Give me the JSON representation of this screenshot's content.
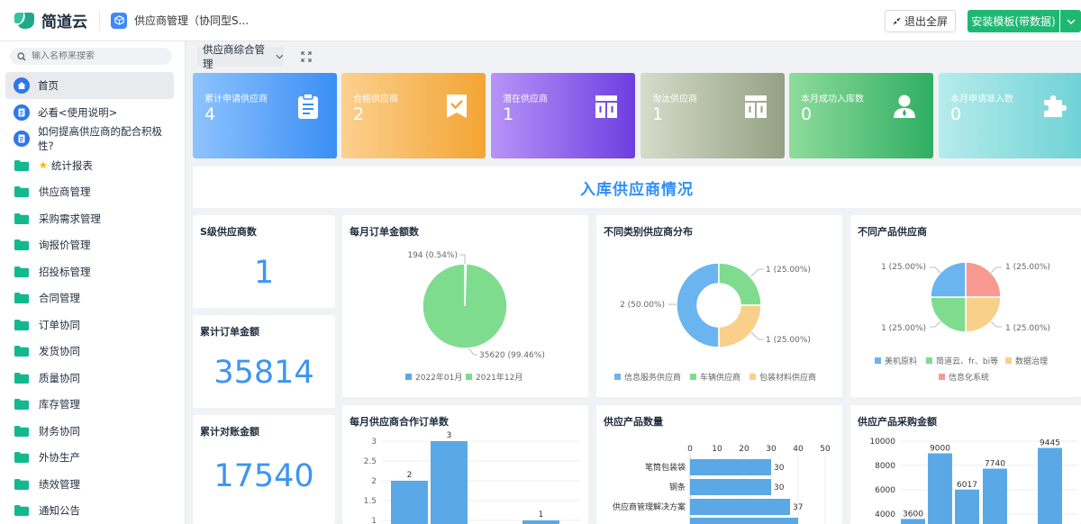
{
  "topbar": {
    "logo_text": "简道云",
    "app_title": "供应商管理（协同型S...",
    "exit_label": "退出全屏",
    "install_label": "安装模板(带数据)"
  },
  "sidebar": {
    "search_placeholder": "输入名称来搜索",
    "items": [
      {
        "label": "首页",
        "type": "home"
      },
      {
        "label": "必看<使用说明>",
        "type": "doc"
      },
      {
        "label": "如何提高供应商的配合积极性?",
        "type": "doc"
      },
      {
        "label": "统计报表",
        "type": "folder-star"
      },
      {
        "label": "供应商管理",
        "type": "folder"
      },
      {
        "label": "采购需求管理",
        "type": "folder"
      },
      {
        "label": "询报价管理",
        "type": "folder"
      },
      {
        "label": "招投标管理",
        "type": "folder"
      },
      {
        "label": "合同管理",
        "type": "folder"
      },
      {
        "label": "订单协同",
        "type": "folder"
      },
      {
        "label": "发货协同",
        "type": "folder"
      },
      {
        "label": "质量协同",
        "type": "folder"
      },
      {
        "label": "库存管理",
        "type": "folder"
      },
      {
        "label": "财务协同",
        "type": "folder"
      },
      {
        "label": "外协生产",
        "type": "folder"
      },
      {
        "label": "绩效管理",
        "type": "folder"
      },
      {
        "label": "通知公告",
        "type": "folder"
      }
    ]
  },
  "toolbar": {
    "dashboard_select": "供应商综合管理"
  },
  "kpis": [
    {
      "label": "累计申请供应商",
      "value": "4",
      "icon": "clipboard-icon",
      "from": "#8ec3ff",
      "to": "#3a8ef5"
    },
    {
      "label": "合格供应商",
      "value": "2",
      "icon": "ribbon-check-icon",
      "from": "#fcd08f",
      "to": "#f3a533"
    },
    {
      "label": "潜在供应商",
      "value": "1",
      "icon": "columns-icon",
      "from": "#b794f8",
      "to": "#6d3ee0"
    },
    {
      "label": "淘汰供应商",
      "value": "1",
      "icon": "columns-icon",
      "from": "#d6dccb",
      "to": "#94a183"
    },
    {
      "label": "本月成功入库数",
      "value": "0",
      "icon": "user-icon",
      "from": "#8fdc9c",
      "to": "#2fae62"
    },
    {
      "label": "本月申请准入数",
      "value": "0",
      "icon": "puzzle-icon",
      "from": "#b6ecec",
      "to": "#6fd2d6"
    }
  ],
  "banner": {
    "title": "入库供应商情况"
  },
  "stats": [
    {
      "title": "S级供应商数",
      "value": "1"
    },
    {
      "title": "累计订单金额",
      "value": "35814"
    },
    {
      "title": "累计对账金额",
      "value": "17540"
    }
  ],
  "chart_data": [
    {
      "type": "pie",
      "title": "每月订单金额数",
      "slices": [
        {
          "name": "2022年01月",
          "value": 194,
          "label": "194 (0.54%)",
          "color": "#5aa9e6"
        },
        {
          "name": "2021年12月",
          "value": 35620,
          "label": "35620 (99.46%)",
          "color": "#7fdc8f"
        }
      ]
    },
    {
      "type": "pie",
      "title": "不同类别供应商分布",
      "donut": true,
      "slices": [
        {
          "name": "信息服务供应商",
          "value": 2,
          "label": "2 (50.00%)",
          "color": "#6ab4f0"
        },
        {
          "name": "车辆供应商",
          "value": 1,
          "label": "1 (25.00%)",
          "color": "#7fdc8f"
        },
        {
          "name": "包装材料供应商",
          "value": 1,
          "label": "1 (25.00%)",
          "color": "#f9d08a"
        }
      ]
    },
    {
      "type": "pie",
      "title": "不同产品供应商",
      "slices": [
        {
          "name": "美机原料",
          "value": 1,
          "label": "1 (25.00%)",
          "color": "#6ab4f0"
        },
        {
          "name": "简道云、fr、bi等",
          "value": 1,
          "label": "1 (25.00%)",
          "color": "#7fdc8f"
        },
        {
          "name": "数据治理",
          "value": 1,
          "label": "1 (25.00%)",
          "color": "#f9d08a"
        },
        {
          "name": "信息化系统",
          "value": 1,
          "label": "1 (25.00%)",
          "color": "#f89a92"
        }
      ]
    },
    {
      "type": "bar",
      "title": "每月供应商合作订单数",
      "yticks": [
        "3",
        "2.5",
        "2",
        "1.5",
        "1"
      ],
      "values": [
        2,
        3,
        1
      ],
      "ylim": [
        1,
        3
      ],
      "color": "#5aa9e6"
    },
    {
      "type": "bar",
      "orientation": "horizontal",
      "title": "供应产品数量",
      "xticks": [
        "0",
        "10",
        "20",
        "30",
        "40",
        "50"
      ],
      "categories": [
        "笔筒包装袋",
        "钢条",
        "供应商管理解决方案"
      ],
      "values": [
        30,
        30,
        37
      ],
      "xlim": [
        0,
        50
      ],
      "color": "#5aa9e6"
    },
    {
      "type": "bar",
      "title": "供应产品采购金额",
      "yticks": [
        "10000",
        "8000",
        "6000",
        "4000"
      ],
      "values": [
        3600,
        9000,
        6017,
        7740,
        9445
      ],
      "ylim": [
        4000,
        10000
      ],
      "color": "#5aa9e6"
    }
  ]
}
